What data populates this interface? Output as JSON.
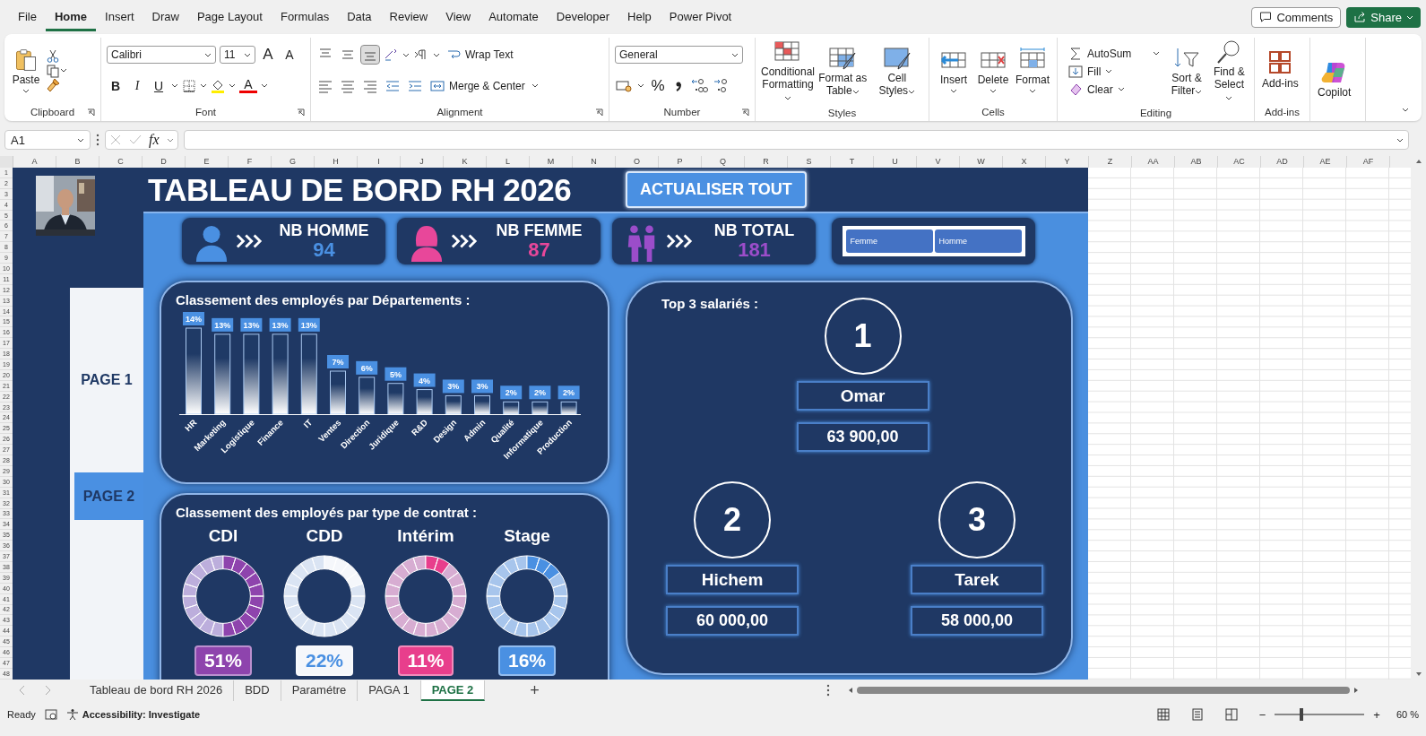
{
  "menu_tabs": [
    {
      "label": "File",
      "selected": false
    },
    {
      "label": "Home",
      "selected": true
    },
    {
      "label": "Insert",
      "selected": false
    },
    {
      "label": "Draw",
      "selected": false
    },
    {
      "label": "Page Layout",
      "selected": false
    },
    {
      "label": "Formulas",
      "selected": false
    },
    {
      "label": "Data",
      "selected": false
    },
    {
      "label": "Review",
      "selected": false
    },
    {
      "label": "View",
      "selected": false
    },
    {
      "label": "Automate",
      "selected": false
    },
    {
      "label": "Developer",
      "selected": false
    },
    {
      "label": "Help",
      "selected": false
    },
    {
      "label": "Power Pivot",
      "selected": false
    }
  ],
  "header_buttons": {
    "comments": "Comments",
    "share": "Share"
  },
  "ribbon": {
    "clipboard": {
      "name": "Clipboard",
      "paste": "Paste"
    },
    "font": {
      "name": "Font",
      "family": "Calibri",
      "size": "11",
      "grow": "A",
      "shrink": "A",
      "bold": "B",
      "italic": "I",
      "underline": "U",
      "font_color_letter": "A"
    },
    "alignment": {
      "name": "Alignment",
      "valign": [
        {
          "selected": false
        },
        {
          "selected": false
        },
        {
          "selected": true
        }
      ],
      "wrap": "Wrap Text",
      "merge": "Merge & Center"
    },
    "number": {
      "name": "Number",
      "format": "General",
      "percent": "%"
    },
    "styles": {
      "name": "Styles",
      "buttons": [
        "Conditional Formatting",
        "Format as Table",
        "Cell Styles"
      ]
    },
    "cells": {
      "name": "Cells",
      "buttons": [
        "Insert",
        "Delete",
        "Format"
      ]
    },
    "editing": {
      "name": "Editing",
      "autosum": "AutoSum",
      "fill": "Fill",
      "clear": "Clear",
      "buttons": [
        "Sort & Filter",
        "Find & Select"
      ]
    },
    "addins": {
      "name": "Add-ins",
      "button": "Add-ins"
    },
    "copilot": {
      "button": "Copilot"
    }
  },
  "formula_bar": {
    "name_box": "A1",
    "fx": "fx"
  },
  "columns": [
    "A",
    "B",
    "C",
    "D",
    "E",
    "F",
    "G",
    "H",
    "I",
    "J",
    "K",
    "L",
    "M",
    "N",
    "O",
    "P",
    "Q",
    "R",
    "S",
    "T",
    "U",
    "V",
    "W",
    "X",
    "Y",
    "Z",
    "AA",
    "AB",
    "AC",
    "AD",
    "AE",
    "AF"
  ],
  "rows": [
    "1",
    "2",
    "3",
    "4",
    "5",
    "6",
    "7",
    "8",
    "9",
    "10",
    "11",
    "12",
    "13",
    "14",
    "15",
    "16",
    "17",
    "18",
    "19",
    "20",
    "21",
    "22",
    "23",
    "24",
    "25",
    "26",
    "27",
    "28",
    "29",
    "30",
    "31",
    "32",
    "33",
    "34",
    "35",
    "36",
    "37",
    "38",
    "39",
    "40",
    "41",
    "42",
    "43",
    "44",
    "45",
    "46",
    "47",
    "48"
  ],
  "dashboard": {
    "nav": [
      {
        "label": "PAGE 1",
        "selected": false
      },
      {
        "label": "PAGE 2",
        "selected": true
      }
    ],
    "title": "TABLEAU DE BORD RH 2026",
    "refresh_button": "ACTUALISER TOUT",
    "kpis": [
      {
        "kind": "male",
        "label": "NB HOMME",
        "value": "94",
        "color": "#4a90e2"
      },
      {
        "kind": "female",
        "label": "NB FEMME",
        "value": "87",
        "color": "#e8479a"
      },
      {
        "kind": "couple",
        "label": "NB TOTAL",
        "value": "181",
        "color": "#9b4dca"
      }
    ],
    "slicer": [
      {
        "label": "Femme",
        "selected": true
      },
      {
        "label": "Homme",
        "selected": true
      }
    ],
    "departments": {
      "chart_data": {
        "type": "bar",
        "title": "Classement des employés par Départements :",
        "categories": [
          "HR",
          "Marketing",
          "Logistique",
          "Finance",
          "IT",
          "Ventes",
          "Direction",
          "Juridique",
          "R&D",
          "Design",
          "Admin",
          "Qualité",
          "Informatique",
          "Production"
        ],
        "values": [
          14,
          13,
          13,
          13,
          13,
          7,
          6,
          5,
          4,
          3,
          3,
          2,
          2,
          2
        ],
        "data_labels": true,
        "value_labels": [
          "14%",
          "13%",
          "13%",
          "13%",
          "13%",
          "7%",
          "6%",
          "5%",
          "4%",
          "3%",
          "3%",
          "2%",
          "2%",
          "2%"
        ]
      }
    },
    "contracts": {
      "title": "Classement des employés par type de contrat :",
      "items": [
        {
          "label": "CDI",
          "value": "51%",
          "color": "#8e44ad"
        },
        {
          "label": "CDD",
          "value": "22%",
          "color": "#f5f7fb"
        },
        {
          "label": "Intérim",
          "value": "11%",
          "color": "#e83e8c"
        },
        {
          "label": "Stage",
          "value": "16%",
          "color": "#4a90e2"
        }
      ]
    },
    "top3": {
      "title": "Top 3 salariés :",
      "items": [
        {
          "rank": "1",
          "name": "Omar",
          "salary": "63 900,00"
        },
        {
          "rank": "2",
          "name": "Hichem",
          "salary": "60 000,00"
        },
        {
          "rank": "3",
          "name": "Tarek",
          "salary": "58 000,00"
        }
      ]
    }
  },
  "sheet_tabs": [
    {
      "label": "Tableau de bord RH 2026",
      "selected": false
    },
    {
      "label": "BDD",
      "selected": false
    },
    {
      "label": "Paramétre",
      "selected": false
    },
    {
      "label": "PAGA 1",
      "selected": false
    },
    {
      "label": "PAGE 2",
      "selected": true
    }
  ],
  "add_sheet": "+",
  "status_bar": {
    "ready": "Ready",
    "accessibility": "Accessibility: Investigate",
    "zoom_out": "−",
    "zoom_in": "+",
    "zoom": "60 %",
    "zoom_slider": {
      "level": 0.3
    }
  }
}
